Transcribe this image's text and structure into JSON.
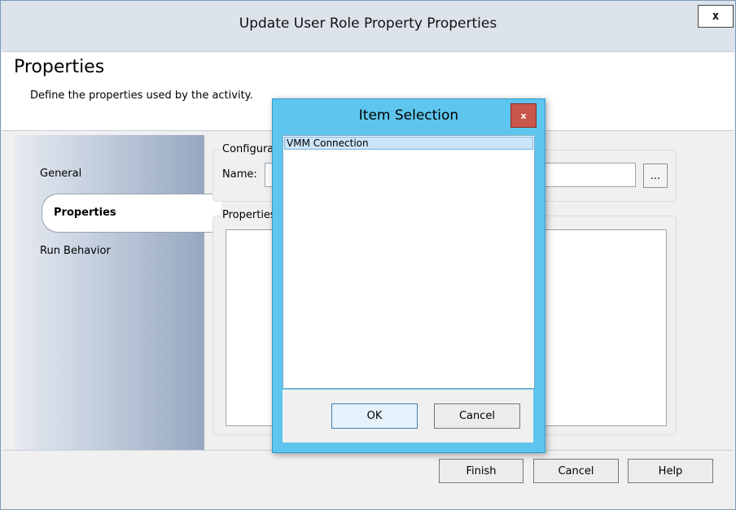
{
  "window": {
    "title": "Update User Role Property Properties",
    "close_label": "x"
  },
  "header": {
    "title": "Properties",
    "description": "Define the properties used by the activity."
  },
  "nav": {
    "items": [
      {
        "label": "General"
      },
      {
        "label": "Properties"
      },
      {
        "label": "Run Behavior"
      }
    ]
  },
  "config": {
    "group_label": "Configuration",
    "name_label": "Name:",
    "name_value": "",
    "ellipsis_label": "..."
  },
  "properties": {
    "group_label": "Properties"
  },
  "footer": {
    "finish_label": "Finish",
    "cancel_label": "Cancel",
    "help_label": "Help"
  },
  "dialog": {
    "title": "Item Selection",
    "close_label": "x",
    "items": [
      {
        "label": "VMM Connection",
        "selected": true
      }
    ],
    "ok_label": "OK",
    "cancel_label": "Cancel"
  }
}
